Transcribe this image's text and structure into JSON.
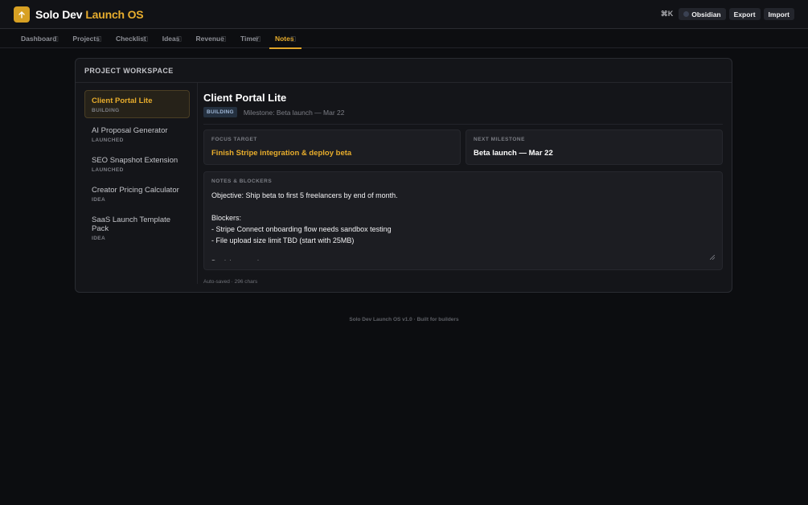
{
  "app": {
    "name_part1": "Solo Dev",
    "name_part2": "Launch OS"
  },
  "header": {
    "shortcut": "⌘K",
    "theme_label": "Obsidian",
    "export_label": "Export",
    "import_label": "Import"
  },
  "nav": {
    "tabs": [
      {
        "label": "Dashboard",
        "hint": "⃞"
      },
      {
        "label": "Projects",
        "hint": "⃞"
      },
      {
        "label": "Checklist",
        "hint": "⃞"
      },
      {
        "label": "Ideas",
        "hint": "⃞"
      },
      {
        "label": "Revenue",
        "hint": "⃞"
      },
      {
        "label": "Timer",
        "hint": "⃞"
      },
      {
        "label": "Notes",
        "hint": "⃞"
      }
    ],
    "active_index": 6
  },
  "workspace": {
    "title": "PROJECT WORKSPACE",
    "projects": [
      {
        "name": "Client Portal Lite",
        "status": "BUILDING"
      },
      {
        "name": "AI Proposal Generator",
        "status": "LAUNCHED"
      },
      {
        "name": "SEO Snapshot Extension",
        "status": "LAUNCHED"
      },
      {
        "name": "Creator Pricing Calculator",
        "status": "IDEA"
      },
      {
        "name": "SaaS Launch Template Pack",
        "status": "IDEA"
      }
    ],
    "selected": {
      "name": "Client Portal Lite",
      "status": "BUILDING",
      "milestone_line": "Milestone: Beta launch — Mar 22",
      "focus_label": "FOCUS TARGET",
      "focus_value": "Finish Stripe integration & deploy beta",
      "next_label": "NEXT MILESTONE",
      "next_value": "Beta launch — Mar 22",
      "notes_label": "NOTES & BLOCKERS",
      "notes": "Objective: Ship beta to first 5 freelancers by end of month.\n\nBlockers:\n- Stripe Connect onboarding flow needs sandbox testing\n- File upload size limit TBD (start with 25MB)\n\nDecisions made:",
      "autosave": "Auto-saved · 296 chars"
    }
  },
  "footer": {
    "text": "Solo Dev Launch OS v1.0 · Built for builders"
  },
  "colors": {
    "accent": "#e8ad2c",
    "background": "#0c0d10",
    "panel": "#141519"
  }
}
